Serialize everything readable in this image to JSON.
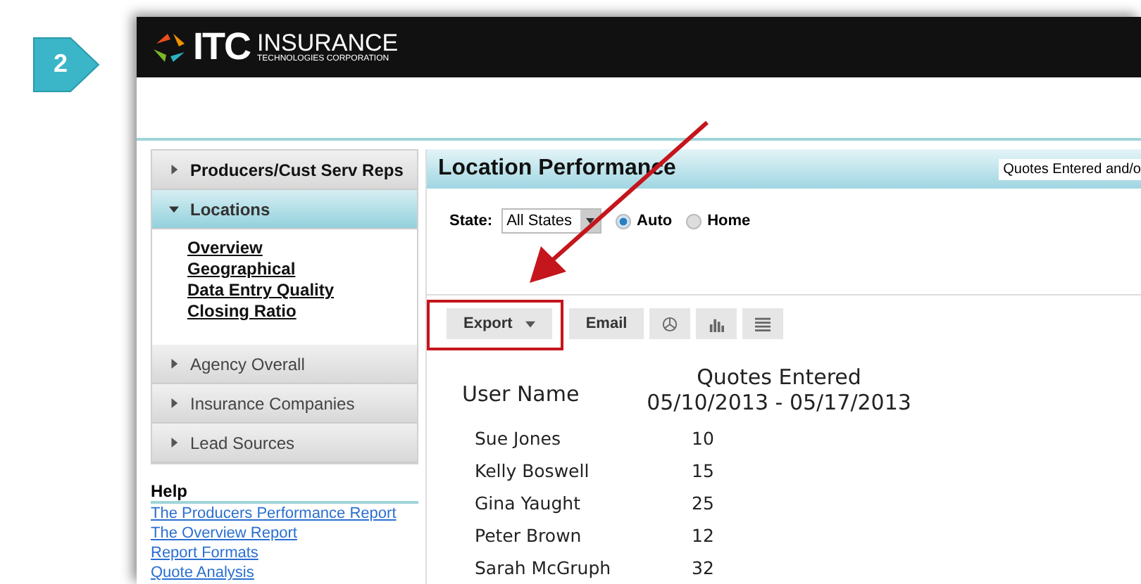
{
  "step_badge": {
    "label": "2"
  },
  "header": {
    "logo_mark": "ITC",
    "logo_word": "INSURANCE",
    "logo_tagline": "TECHNOLOGIES CORPORATION"
  },
  "sidebar": {
    "sections": [
      {
        "label": "Producers/Cust Serv Reps",
        "expanded": false
      },
      {
        "label": "Locations",
        "expanded": true,
        "links": [
          "Overview",
          "Geographical",
          "Data Entry Quality",
          "Closing Ratio"
        ]
      },
      {
        "label": "Agency Overall",
        "expanded": false
      },
      {
        "label": "Insurance Companies",
        "expanded": false
      },
      {
        "label": "Lead Sources",
        "expanded": false
      }
    ],
    "help": {
      "title": "Help",
      "links": [
        "The Producers Performance Report",
        "The Overview Report",
        "Report Formats",
        "Quote Analysis"
      ]
    }
  },
  "main": {
    "title": "Location Performance",
    "report_select": "Quotes Entered and/o",
    "filters": {
      "state_label": "State:",
      "state_value": "All States",
      "options": [
        {
          "label": "Auto",
          "selected": true
        },
        {
          "label": "Home",
          "selected": false
        }
      ]
    },
    "toolbar": [
      {
        "kind": "dropdown",
        "label": "Export",
        "highlighted": true
      },
      {
        "kind": "text",
        "label": "Email",
        "highlighted": false
      },
      {
        "kind": "pie",
        "highlighted": false
      },
      {
        "kind": "bars",
        "highlighted": false
      },
      {
        "kind": "list",
        "highlighted": false
      }
    ],
    "table": {
      "columns": [
        "User Name",
        "Quotes Entered\n05/10/2013 - 05/17/2013"
      ],
      "rows": [
        [
          "Sue Jones",
          "10"
        ],
        [
          "Kelly Boswell",
          "15"
        ],
        [
          "Gina Yaught",
          "25"
        ],
        [
          "Peter Brown",
          "12"
        ],
        [
          "Sarah McGruph",
          "32"
        ]
      ]
    }
  }
}
